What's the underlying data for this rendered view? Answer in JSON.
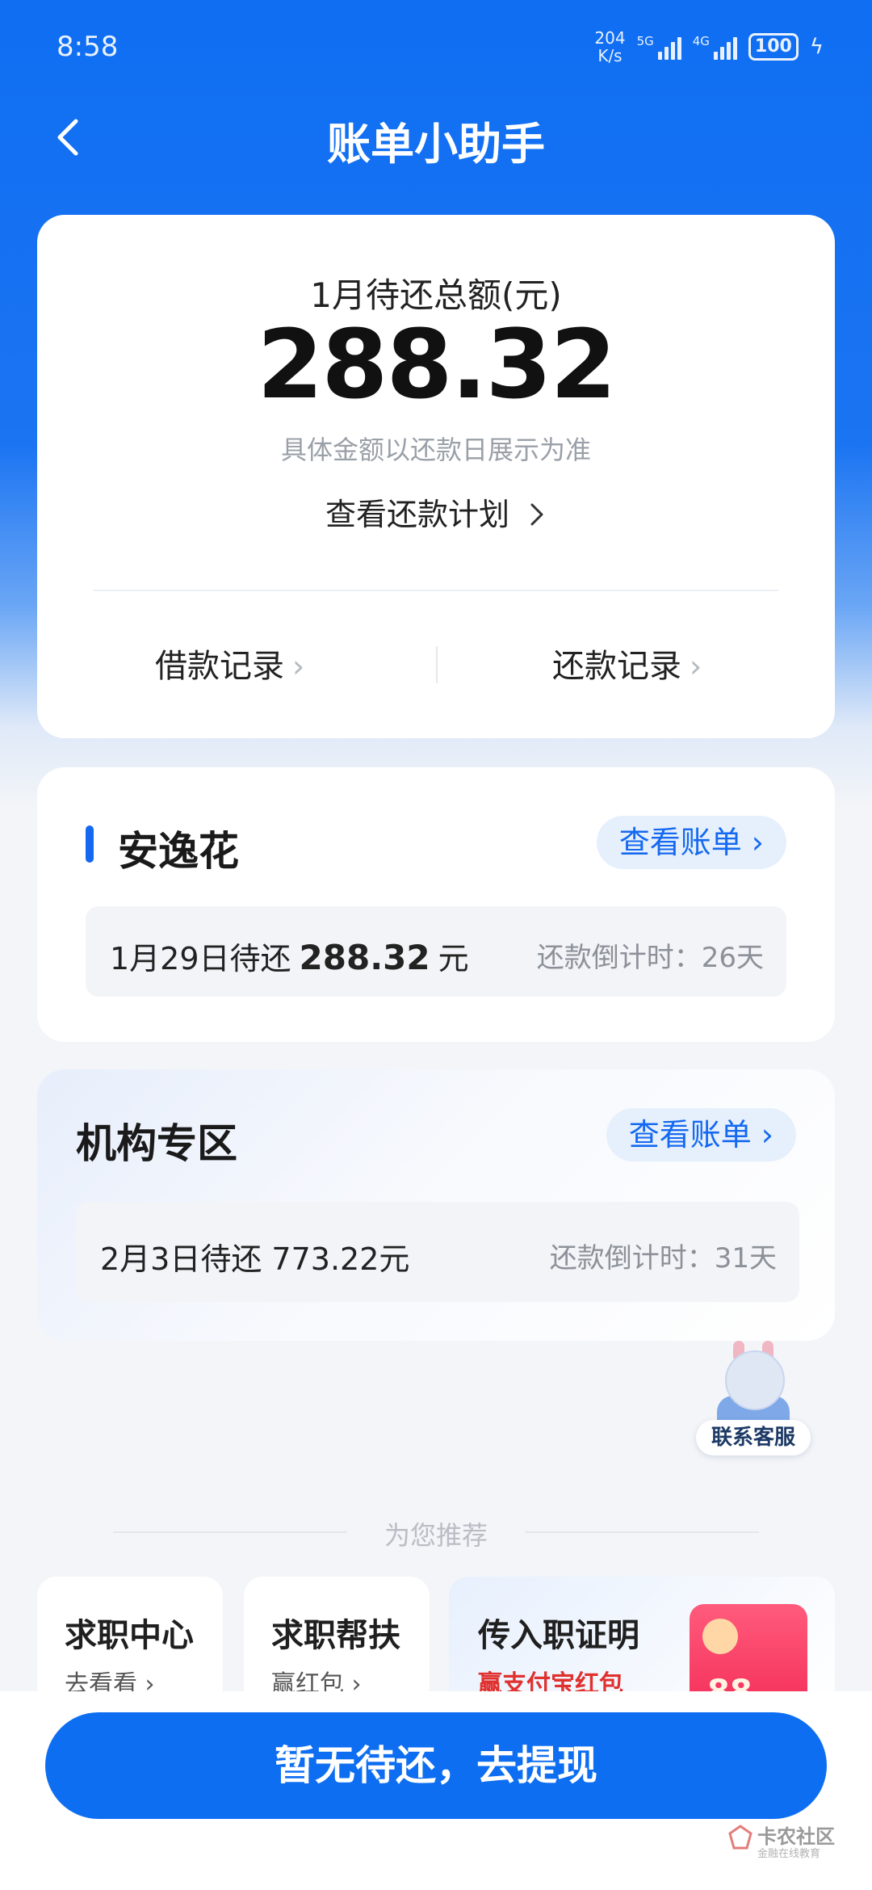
{
  "status_bar": {
    "time": "8:58",
    "net_speed_value": "204",
    "net_speed_unit": "K/s",
    "signal1": "5G",
    "signal2": "4G",
    "battery": "100"
  },
  "nav": {
    "title": "账单小助手"
  },
  "summary": {
    "label": "1月待还总额(元)",
    "amount": "288.32",
    "note": "具体金额以还款日展示为准",
    "plan_link": "查看还款计划",
    "borrow_record": "借款记录",
    "repay_record": "还款记录"
  },
  "product": {
    "name": "安逸花",
    "view_bill": "查看账单",
    "due_prefix": "1月29日待还",
    "due_amount": "288.32",
    "due_unit": "元",
    "countdown": "还款倒计时：26天"
  },
  "institution": {
    "name": "机构专区",
    "view_bill": "查看账单",
    "due_text": "2月3日待还 773.22元",
    "countdown": "还款倒计时：31天"
  },
  "service": {
    "label": "联系客服"
  },
  "recommend": {
    "title": "为您推荐",
    "tiles": [
      {
        "title": "求职中心",
        "sub": "去看看"
      },
      {
        "title": "求职帮扶",
        "sub": "赢红包"
      },
      {
        "title": "传入职证明",
        "sub": "赢支付宝红包",
        "badge": "88"
      }
    ]
  },
  "cta": {
    "label": "暂无待还，去提现"
  },
  "watermark": {
    "main": "卡农社区",
    "sub": "金融在线教育"
  },
  "colors": {
    "brand_blue": "#0d6ef2",
    "accent_red": "#e0312f",
    "pill_bg": "#e6f0fd"
  }
}
